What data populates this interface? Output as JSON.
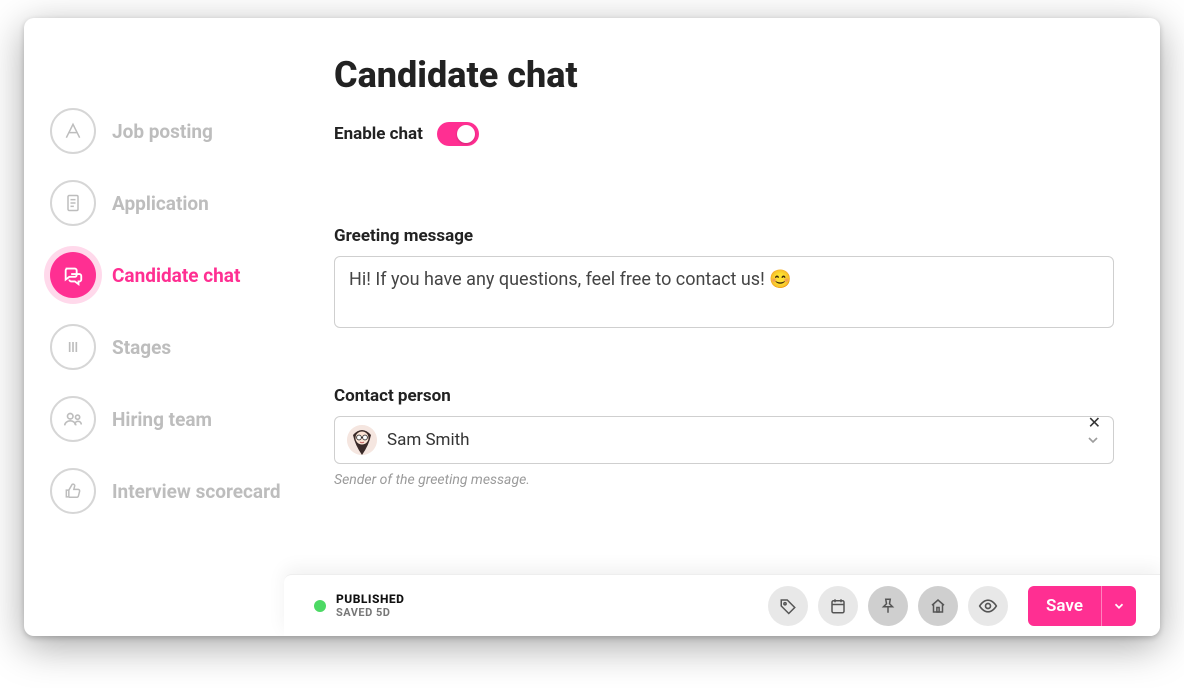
{
  "sidebar": {
    "items": [
      {
        "label": "Job posting",
        "icon": "letter-a-icon"
      },
      {
        "label": "Application",
        "icon": "document-icon"
      },
      {
        "label": "Candidate chat",
        "icon": "chat-icon",
        "active": true
      },
      {
        "label": "Stages",
        "icon": "columns-icon"
      },
      {
        "label": "Hiring team",
        "icon": "people-icon"
      },
      {
        "label": "Interview scorecard",
        "icon": "thumbs-up-icon"
      }
    ]
  },
  "main": {
    "title": "Candidate chat",
    "enable_label": "Enable chat",
    "enabled": true,
    "greeting_label": "Greeting message",
    "greeting_value": "Hi! If you have any questions, feel free to contact us! 😊",
    "contact_label": "Contact person",
    "contact_name": "Sam Smith",
    "contact_helper": "Sender of the greeting message."
  },
  "footer": {
    "status_label": "PUBLISHED",
    "saved_label": "SAVED 5D",
    "save_label": "Save",
    "status_color": "#4cd964",
    "accent_color": "#ff2f92",
    "action_icons": [
      "tag-icon",
      "calendar-icon",
      "pin-icon",
      "house-icon",
      "eye-icon"
    ]
  }
}
